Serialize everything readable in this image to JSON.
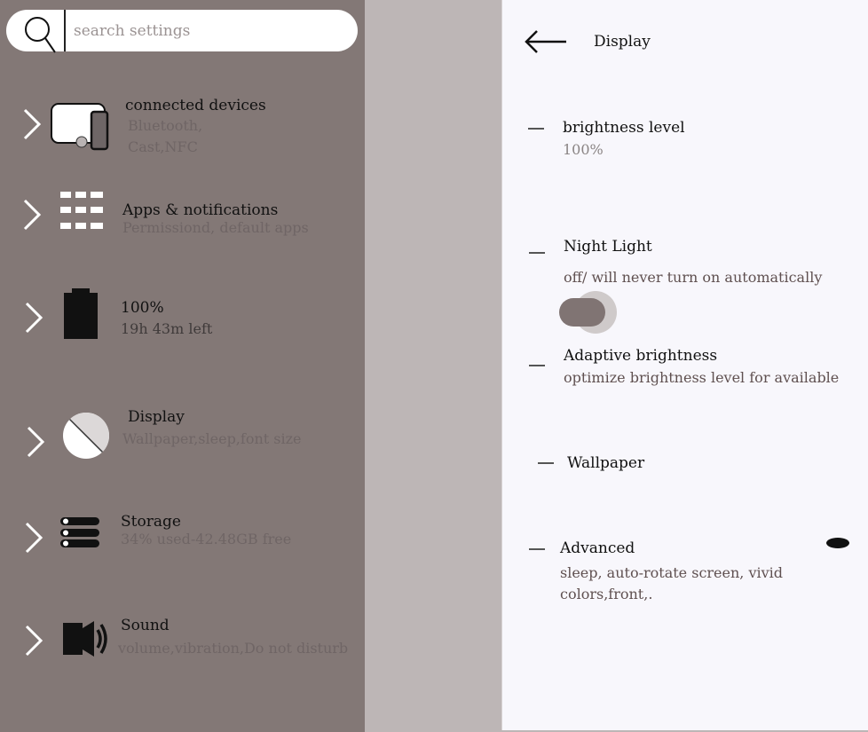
{
  "search": {
    "placeholder": "search settings"
  },
  "sidebar": {
    "items": [
      {
        "title": "connected devices",
        "subtitle_line1": "Bluetooth,",
        "subtitle_line2": "Cast,NFC",
        "icon": "devices-icon"
      },
      {
        "title": "Apps & notifications",
        "subtitle": "Permissiond, default apps",
        "icon": "apps-grid-icon"
      },
      {
        "title": "100%",
        "subtitle": "19h 43m left",
        "icon": "battery-icon"
      },
      {
        "title": "Display",
        "subtitle": "Wallpaper,sleep,font size",
        "icon": "display-icon"
      },
      {
        "title": "Storage",
        "subtitle": "34% used-42.48GB free",
        "icon": "storage-icon"
      },
      {
        "title": "Sound",
        "subtitle": "volume,vibration,Do not disturb",
        "icon": "sound-icon"
      }
    ]
  },
  "panel": {
    "title": "Display",
    "settings": [
      {
        "title": "brightness level",
        "subtitle": "100%"
      },
      {
        "title": "Night Light",
        "subtitle": "off/ will never turn on automatically",
        "toggle": "off"
      },
      {
        "title": "Adaptive brightness",
        "subtitle": "optimize brightness level for available"
      },
      {
        "title": "Wallpaper"
      },
      {
        "title": "Advanced",
        "subtitle_line1": "sleep, auto-rotate screen, vivid",
        "subtitle_line2": "colors,front,."
      }
    ]
  },
  "colors": {
    "sidebar_bg": "#837876",
    "panel_bg": "#f8f7fc",
    "toggle_track": "#807473"
  }
}
